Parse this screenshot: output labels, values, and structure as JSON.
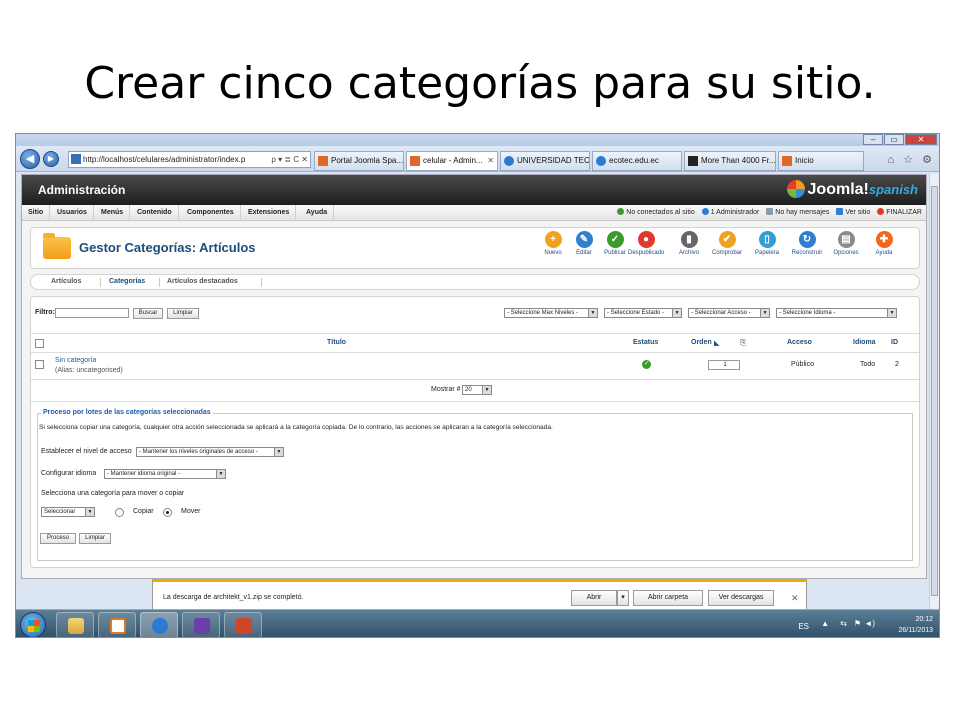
{
  "slide": {
    "title": "Crear cinco categorías para su sitio."
  },
  "browser": {
    "address": "http://localhost/celulares/administrator/index.p",
    "address_controls": "ρ ▾ ≣ C ✕",
    "tabs": [
      {
        "label": "Portal Joomla Spa...",
        "icon": "joomla-icon"
      },
      {
        "label": "celular - Admin...",
        "icon": "joomla-icon",
        "active": true
      },
      {
        "label": "UNIVERSIDAD TEC...",
        "icon": "ie-icon"
      },
      {
        "label": "ecotec.edu.ec",
        "icon": "ie-icon"
      },
      {
        "label": "More Than 4000 Fr...",
        "icon": "mt-icon"
      },
      {
        "label": "Inicio",
        "icon": "joomla-icon"
      }
    ],
    "toolbar_icons": "⌂ ☆ ⚙"
  },
  "joomla": {
    "header_title": "Administración",
    "logo_text": "Joomla!",
    "logo_suffix": "spanish",
    "menu": [
      "Sitio",
      "Usuarios",
      "Menús",
      "Contenido",
      "Componentes",
      "Extensiones",
      "Ayuda"
    ],
    "status": {
      "visitors": "No conectados al sitio",
      "admins": "1 Administrador",
      "messages": "No hay mensajes",
      "view_site": "Ver sitio",
      "logout": "FINALIZAR"
    },
    "page_title": "Gestor Categorías: Artículos",
    "toolbar": [
      {
        "label": "Nuevo",
        "icon": "new-icon",
        "glyph": "+",
        "color": "#f0a21e"
      },
      {
        "label": "Editar",
        "icon": "edit-icon",
        "glyph": "✎",
        "color": "#2f7fd0"
      },
      {
        "label": "Publicar",
        "icon": "publish-icon",
        "glyph": "✓",
        "color": "#3a9a2c"
      },
      {
        "label": "Despublicado",
        "icon": "unpublish-icon",
        "glyph": "●",
        "color": "#e03a2e"
      },
      {
        "label": "Archivo",
        "icon": "archive-icon",
        "glyph": "▮",
        "color": "#666666"
      },
      {
        "label": "Comprobar",
        "icon": "checkin-icon",
        "glyph": "✔",
        "color": "#f0a21e"
      },
      {
        "label": "Papelera",
        "icon": "trash-icon",
        "glyph": "▯",
        "color": "#2f9fd8"
      },
      {
        "label": "Reconstruir",
        "icon": "rebuild-icon",
        "glyph": "↻",
        "color": "#2f7fd0"
      },
      {
        "label": "Opciones",
        "icon": "options-icon",
        "glyph": "▤",
        "color": "#8a8a8a"
      },
      {
        "label": "Ayuda",
        "icon": "help-icon",
        "glyph": "✚",
        "color": "#f06a1e"
      }
    ],
    "subtabs": [
      "Artículos",
      "Categorías",
      "Artículos destacados"
    ],
    "filter": {
      "label": "Filtro:",
      "value": "",
      "search_button": "Buscar",
      "clear_button": "Limpiar",
      "selects": [
        "- Seleccione Max Niveles -",
        "- Seleccione Estado -",
        "- Seleccionar Acceso -",
        "- Seleccione Idioma -"
      ]
    },
    "table": {
      "headers": {
        "title": "Título",
        "status": "Estatus",
        "order": "Orden",
        "access": "Acceso",
        "language": "Idioma",
        "id": "ID"
      },
      "rows": [
        {
          "title": "Sin categoría",
          "alias": "(Alias: uncategorised)",
          "status": "published",
          "order": "1",
          "access": "Público",
          "language": "Todo",
          "id": "2"
        }
      ],
      "show_label": "Mostrar #",
      "show_value": "20"
    },
    "batch": {
      "legend": "Proceso por lotes de las categorías seleccionadas",
      "description": "Si selecciona copiar una categoría, cualquier otra acción seleccionada se aplicará a la categoría copiada. De lo contrario, las acciones se aplicaran a la categoría seleccionada.",
      "access_label": "Establecer el nivel de acceso",
      "access_value": "- Mantener los niveles originales de acceso -",
      "language_label": "Configurar idioma",
      "language_value": "- Mantener idioma original -",
      "move_label": "Selecciona una categoría para mover o copiar",
      "move_value": "Seleccionar",
      "copy_label": "Copiar",
      "move_option": "Mover",
      "process_button": "Proceso",
      "clear_button": "Limpiar"
    }
  },
  "download_bar": {
    "message": "La descarga de architekt_v1.zip se completó.",
    "open": "Abrir",
    "open_folder": "Abrir carpeta",
    "view_downloads": "Ver descargas"
  },
  "taskbar": {
    "language": "ES",
    "time": "20:12",
    "date": "26/11/2013"
  }
}
